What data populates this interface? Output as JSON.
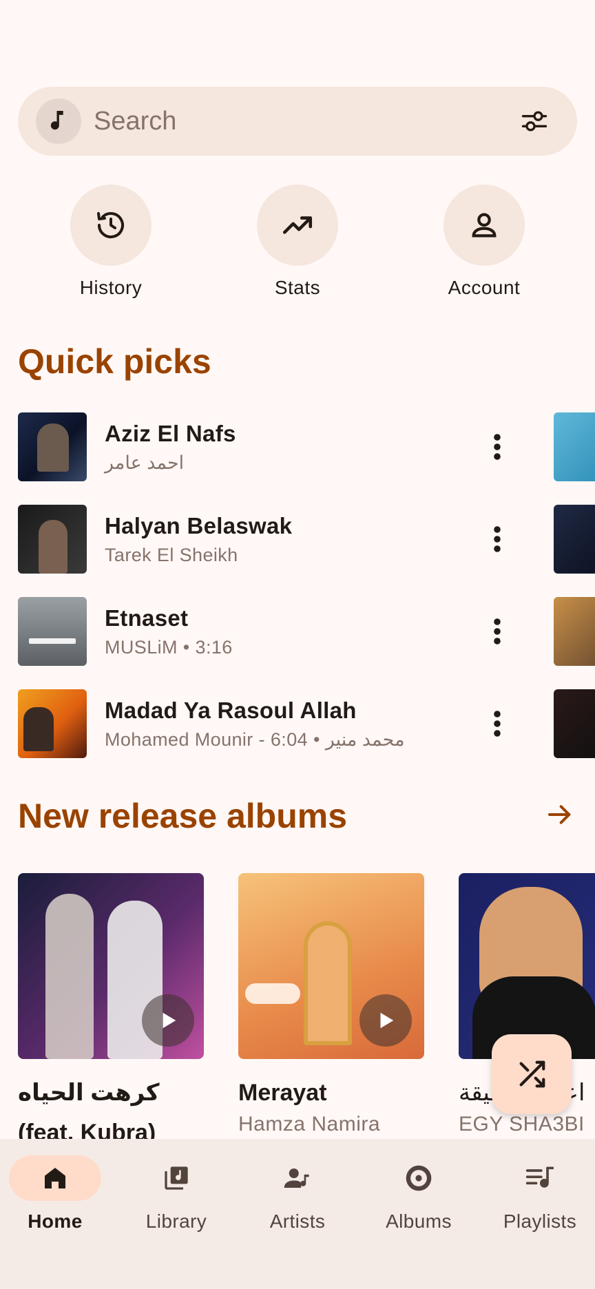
{
  "search": {
    "placeholder": "Search"
  },
  "shortcuts": [
    {
      "label": "History"
    },
    {
      "label": "Stats"
    },
    {
      "label": "Account"
    }
  ],
  "quick_picks": {
    "title": "Quick picks",
    "items": [
      {
        "title": "Aziz El Nafs",
        "subtitle": "احمد عامر"
      },
      {
        "title": "Halyan Belaswak",
        "subtitle": "Tarek El Sheikh"
      },
      {
        "title": "Etnaset",
        "subtitle": "MUSLiM • 3:16"
      },
      {
        "title": "Madad Ya Rasoul Allah",
        "subtitle": "Mohamed Mounir - 6:04 • محمد منير"
      }
    ]
  },
  "new_releases": {
    "title": "New release albums",
    "albums": [
      {
        "title": "كرهت الحياه (feat. Kubra)",
        "artist": ""
      },
      {
        "title": "Merayat",
        "artist": "Hamza Namira"
      },
      {
        "title": "اعلى الحقيقة",
        "artist": "EGY SHA3BI"
      }
    ]
  },
  "nav": [
    {
      "label": "Home",
      "active": true
    },
    {
      "label": "Library",
      "active": false
    },
    {
      "label": "Artists",
      "active": false
    },
    {
      "label": "Albums",
      "active": false
    },
    {
      "label": "Playlists",
      "active": false
    }
  ],
  "colors": {
    "accent": "#9a4300",
    "surface": "#f5e6de",
    "background": "#fff8f6",
    "fab": "#ffdbca"
  }
}
